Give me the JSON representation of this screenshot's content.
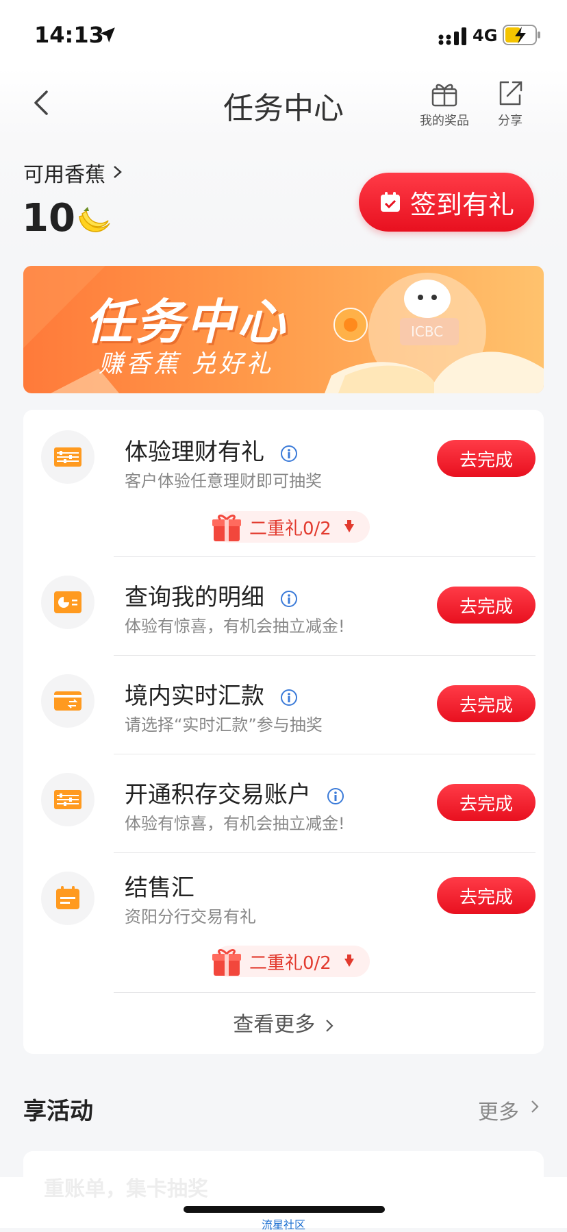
{
  "status_bar": {
    "time": "14:13",
    "network": "4G"
  },
  "nav": {
    "title": "任务中心",
    "prizes_label": "我的奖品",
    "share_label": "分享"
  },
  "balance": {
    "label": "可用香蕉",
    "value": "10"
  },
  "checkin_label": "签到有礼",
  "banner": {
    "title": "任务中心",
    "subtitle": "赚香蕉 兑好礼",
    "logo_text": "ICBC"
  },
  "tasks": [
    {
      "title": "体验理财有礼",
      "desc": "客户体验任意理财即可抽奖",
      "button": "去完成",
      "bonus": "二重礼0/2"
    },
    {
      "title": "查询我的明细",
      "desc": "体验有惊喜，有机会抽立减金!",
      "button": "去完成"
    },
    {
      "title": "境内实时汇款",
      "desc": "请选择“实时汇款”参与抽奖",
      "button": "去完成"
    },
    {
      "title": "开通积存交易账户",
      "desc": "体验有惊喜，有机会抽立减金!",
      "button": "去完成"
    },
    {
      "title": "结售汇",
      "desc": "资阳分行交易有礼",
      "button": "去完成",
      "bonus": "二重礼0/2"
    }
  ],
  "view_more": "查看更多",
  "activities": {
    "title": "享活动",
    "more": "更多",
    "first_item": "重账单，集卡抽奖"
  },
  "watermark": "流星社区",
  "colors": {
    "accent_red": "#e8101f",
    "orange": "#ff8c3a",
    "icon_orange": "#ff9a1f"
  }
}
